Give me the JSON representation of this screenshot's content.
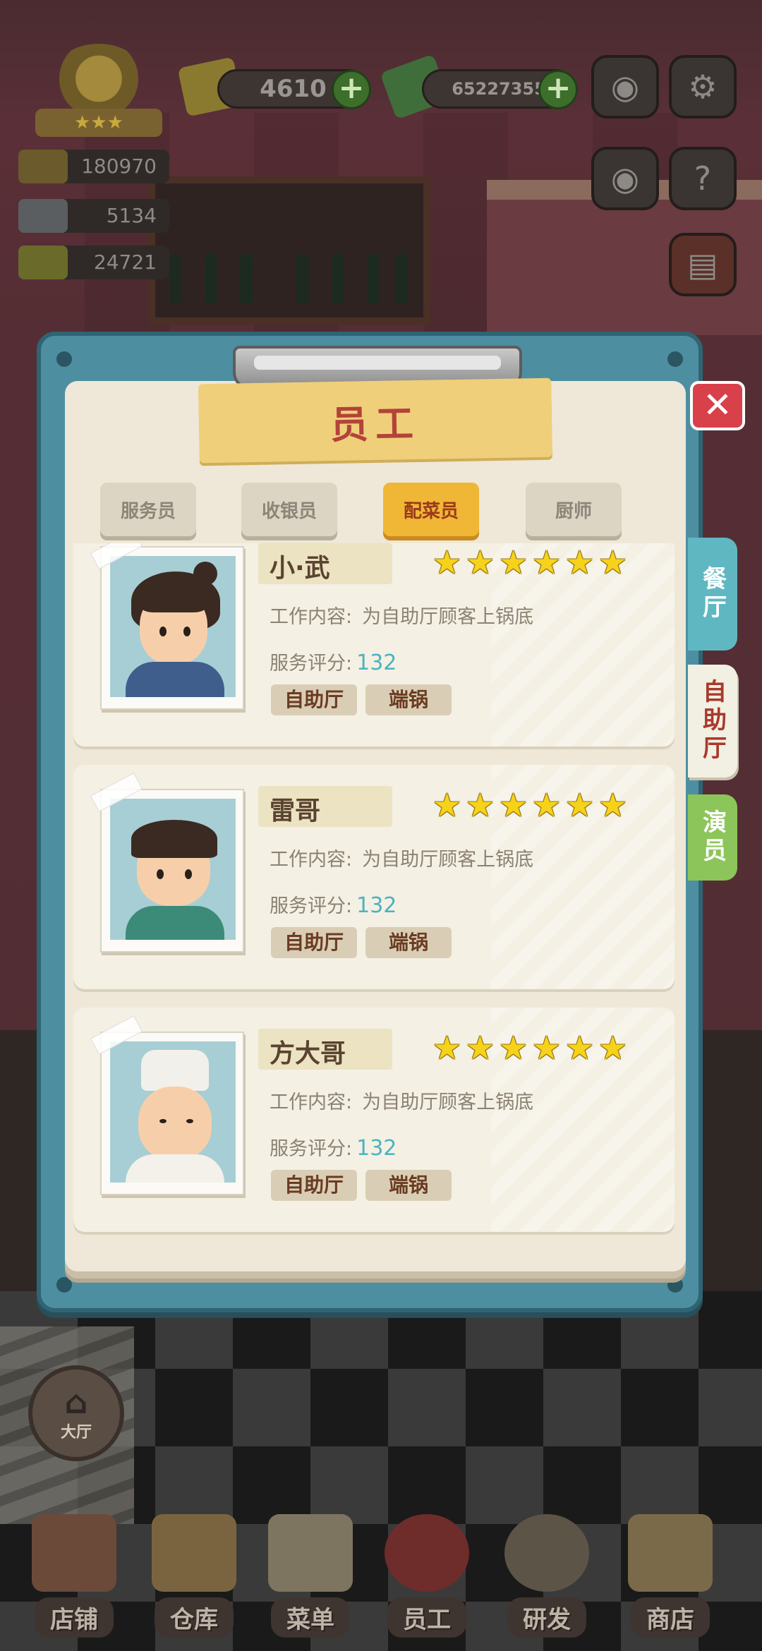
{
  "hud": {
    "gems": "4610",
    "cash": "65227355",
    "stats": [
      "180970",
      "5134",
      "24721"
    ],
    "badge_stars": "★★★",
    "icons": {
      "plus_gems": "plus-icon",
      "plus_cash": "plus-icon",
      "camera": "camera-icon",
      "settings": "gear-icon",
      "eye": "eye-icon",
      "help_book": "book-help-icon",
      "recipe": "recipe-book-icon"
    }
  },
  "modal": {
    "title": "员工",
    "close_glyph": "✕",
    "tabs": [
      {
        "label": "服务员",
        "active": false
      },
      {
        "label": "收银员",
        "active": false
      },
      {
        "label": "配菜员",
        "active": true
      },
      {
        "label": "厨师",
        "active": false
      }
    ],
    "side_tabs": [
      {
        "label": "餐厅",
        "color": "#5fb8c1"
      },
      {
        "label": "自助厅",
        "color": "#f2efe3"
      },
      {
        "label": "演员",
        "color": "#8cc55a"
      }
    ],
    "cards": [
      {
        "name": "小·武",
        "stars": 6,
        "job_label": "工作内容:",
        "job_value": "为自助厅顾客上锅底",
        "score_label": "服务评分:",
        "score": "132",
        "tags": [
          "自助厅",
          "端锅"
        ]
      },
      {
        "name": "雷哥",
        "stars": 6,
        "job_label": "工作内容:",
        "job_value": "为自助厅顾客上锅底",
        "score_label": "服务评分:",
        "score": "132",
        "tags": [
          "自助厅",
          "端锅"
        ]
      },
      {
        "name": "方大哥",
        "stars": 6,
        "job_label": "工作内容:",
        "job_value": "为自助厅顾客上锅底",
        "score_label": "服务评分:",
        "score": "132",
        "tags": [
          "自助厅",
          "端锅"
        ]
      }
    ]
  },
  "hall_button": {
    "label": "大厅"
  },
  "bottom_nav": [
    {
      "label": "店铺",
      "icon": "shop-icon"
    },
    {
      "label": "仓库",
      "icon": "warehouse-icon"
    },
    {
      "label": "菜单",
      "icon": "menu-clipboard-icon"
    },
    {
      "label": "员工",
      "icon": "staff-icon"
    },
    {
      "label": "研发",
      "icon": "research-wok-icon"
    },
    {
      "label": "商店",
      "icon": "store-icon"
    }
  ],
  "colors": {
    "accent_tab": "#f0b736",
    "title_text": "#b3433a",
    "score_text": "#4cb3be",
    "star": "#f6d31a",
    "close_button": "#d8404a"
  }
}
